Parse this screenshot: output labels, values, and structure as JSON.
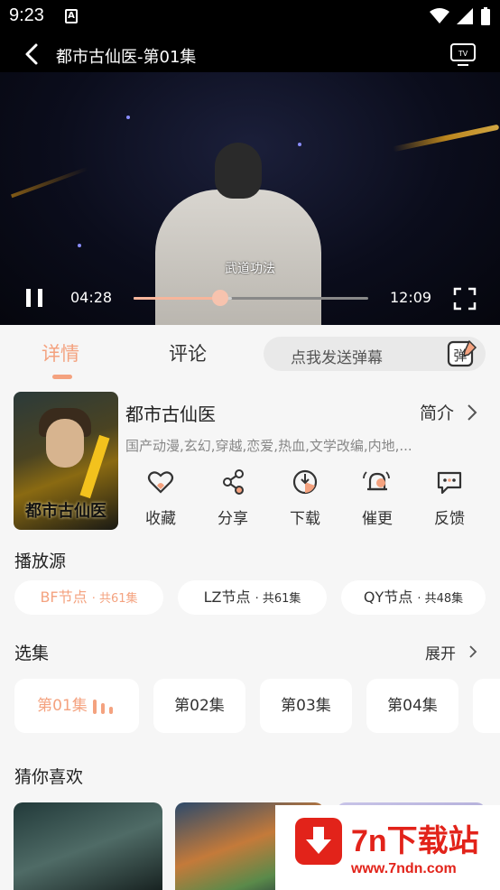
{
  "status_bar": {
    "time": "9:23",
    "notif_glyph": "A"
  },
  "player": {
    "title": "都市古仙医-第01集",
    "subtitle": "武道功法",
    "current_time": "04:28",
    "total_time": "12:09",
    "progress_fraction": 0.37,
    "buffered_fraction": 0.42
  },
  "tabs": {
    "detail": "详情",
    "comment": "评论"
  },
  "danmaku": {
    "placeholder": "点我发送弹幕",
    "icon_text": "弹"
  },
  "show": {
    "poster_text": "都市古仙医",
    "title": "都市古仙医",
    "intro_label": "简介",
    "tags": "国产动漫,玄幻,穿越,恋爱,热血,文学改编,内地,..."
  },
  "actions": [
    {
      "label": "收藏",
      "icon": "heart-icon"
    },
    {
      "label": "分享",
      "icon": "share-icon"
    },
    {
      "label": "下载",
      "icon": "download-icon"
    },
    {
      "label": "催更",
      "icon": "bell-icon"
    },
    {
      "label": "反馈",
      "icon": "feedback-icon"
    }
  ],
  "sources": {
    "title": "播放源",
    "items": [
      {
        "name": "BF节点",
        "count": "· 共61集"
      },
      {
        "name": "LZ节点",
        "count": "· 共61集"
      },
      {
        "name": "QY节点",
        "count": "· 共48集"
      }
    ]
  },
  "episodes": {
    "title": "选集",
    "expand_label": "展开",
    "items": [
      "第01集",
      "第02集",
      "第03集",
      "第04集"
    ]
  },
  "recommend": {
    "title": "猜你喜欢"
  },
  "watermark": {
    "title": "7n下载站",
    "url": "www.7ndn.com"
  },
  "colors": {
    "accent": "#f4a27f",
    "background": "#f6f6f6",
    "watermark_red": "#e2231a"
  }
}
